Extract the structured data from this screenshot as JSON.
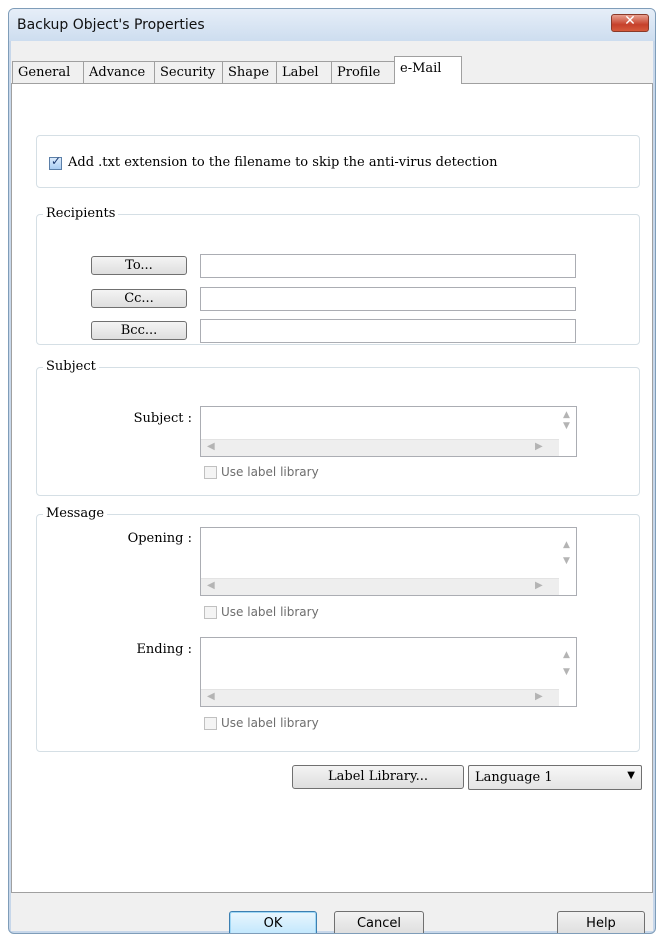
{
  "window": {
    "title": "Backup Object's Properties"
  },
  "tabs": [
    {
      "label": "General"
    },
    {
      "label": "Advance"
    },
    {
      "label": "Security"
    },
    {
      "label": "Shape"
    },
    {
      "label": "Label"
    },
    {
      "label": "Profile"
    },
    {
      "label": "e-Mail",
      "active": true
    }
  ],
  "options": {
    "add_txt_extension": {
      "label": "Add .txt extension to the filename to skip the anti-virus detection",
      "checked": true
    }
  },
  "recipients": {
    "legend": "Recipients",
    "to_button": "To...",
    "cc_button": "Cc...",
    "bcc_button": "Bcc...",
    "to_value": "",
    "cc_value": "",
    "bcc_value": ""
  },
  "subject": {
    "legend": "Subject",
    "label": "Subject :",
    "use_label_library": "Use label library"
  },
  "message": {
    "legend": "Message",
    "opening_label": "Opening :",
    "ending_label": "Ending :",
    "opening_use_label_library": "Use label library",
    "ending_use_label_library": "Use label library"
  },
  "label_library_button": "Label Library...",
  "language_select": {
    "value": "Language 1"
  },
  "footer": {
    "ok": "OK",
    "cancel": "Cancel",
    "help": "Help"
  },
  "icons": {
    "close": "close-icon",
    "scroll_left": "arrow-left-icon",
    "scroll_right": "arrow-right-icon",
    "scroll_up": "arrow-up-icon",
    "scroll_down": "arrow-down-icon",
    "dropdown": "chevron-down-icon"
  },
  "colors": {
    "title_bar": "#c7d7ea",
    "close_button": "#c6412b",
    "default_button": "#bee6fd"
  }
}
